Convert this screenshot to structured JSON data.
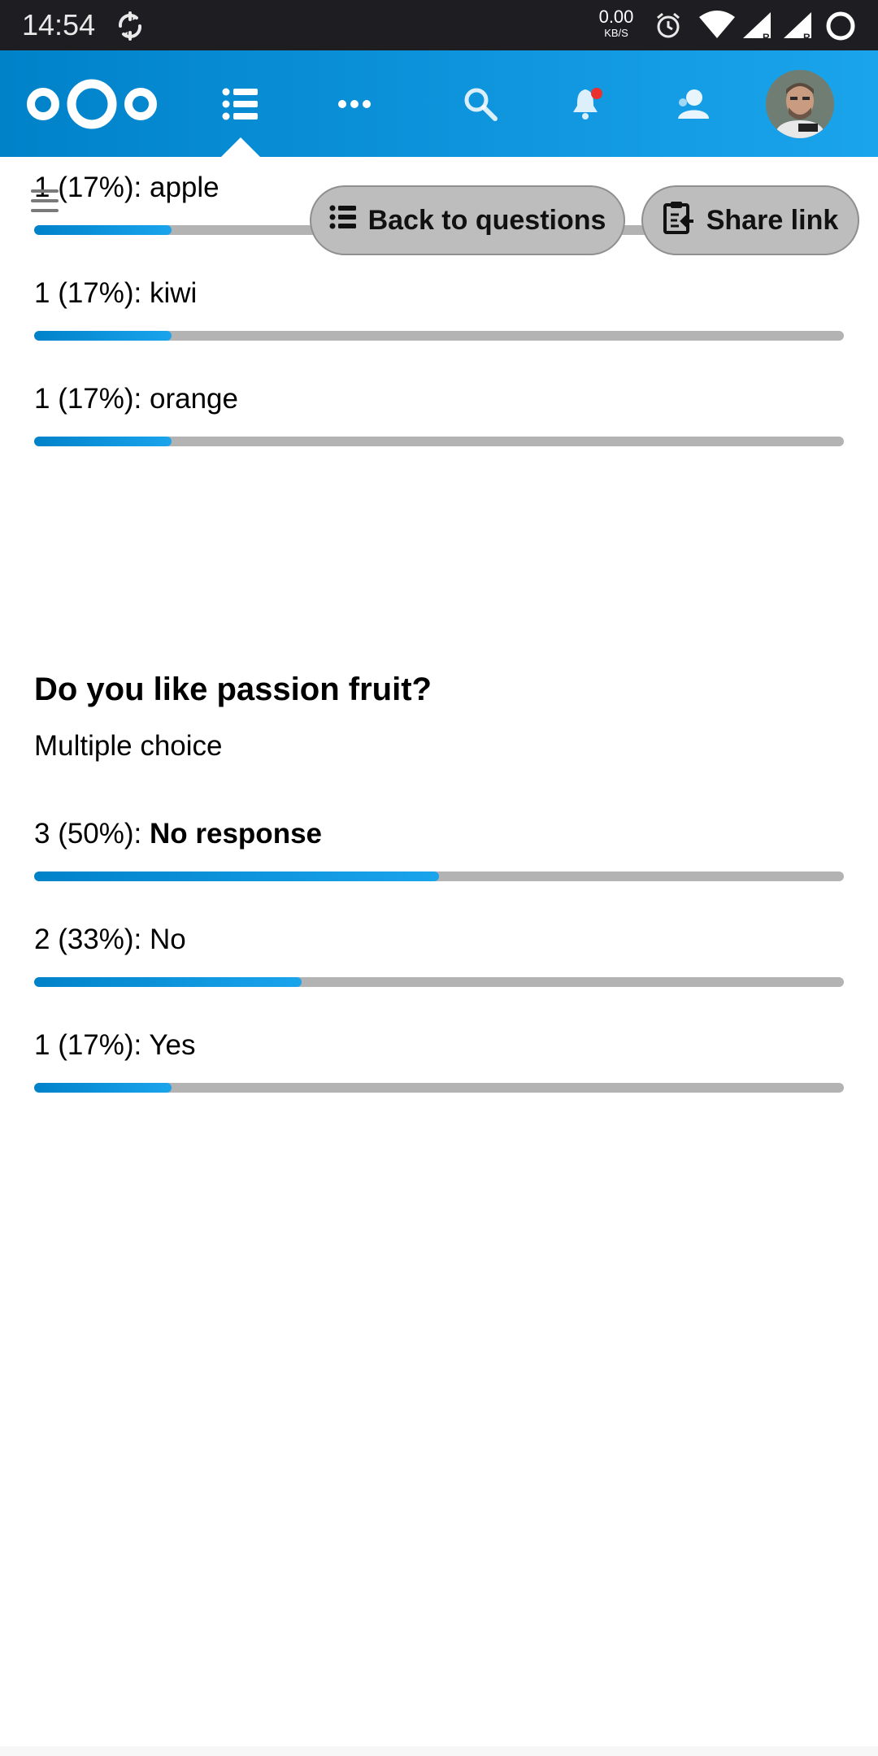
{
  "status_bar": {
    "time": "14:54",
    "speed_value": "0.00",
    "speed_unit": "KB/S",
    "icons": [
      "sync-icon",
      "alarm-icon",
      "wifi-icon",
      "signal-icon",
      "signal-icon",
      "battery-icon"
    ],
    "signal_labels": [
      "R",
      "R"
    ]
  },
  "header": {
    "logo": "nextcloud-logo",
    "icons": [
      "forms-list-icon",
      "more-apps-icon",
      "search-icon",
      "notifications-icon",
      "contacts-icon"
    ],
    "accent_gradient": [
      "#0082c9",
      "#1aa4ec"
    ],
    "notification_dot_color": "#e9322d"
  },
  "toolbar": {
    "back_label": "Back to questions",
    "share_label": "Share link"
  },
  "prev_question": {
    "results": [
      {
        "count_text": "1 (17%): ",
        "answer": "apple",
        "fraction": 0.17,
        "bold": false
      },
      {
        "count_text": "1 (17%): ",
        "answer": "kiwi",
        "fraction": 0.17,
        "bold": false
      },
      {
        "count_text": "1 (17%): ",
        "answer": "orange",
        "fraction": 0.17,
        "bold": false
      }
    ]
  },
  "question": {
    "title": "Do you like passion fruit?",
    "type": "Multiple choice",
    "results": [
      {
        "count_text": "3 (50%): ",
        "answer": "No response",
        "fraction": 0.5,
        "bold": true
      },
      {
        "count_text": "2 (33%): ",
        "answer": "No",
        "fraction": 0.33,
        "bold": false
      },
      {
        "count_text": "1 (17%): ",
        "answer": "Yes",
        "fraction": 0.17,
        "bold": false
      }
    ]
  }
}
